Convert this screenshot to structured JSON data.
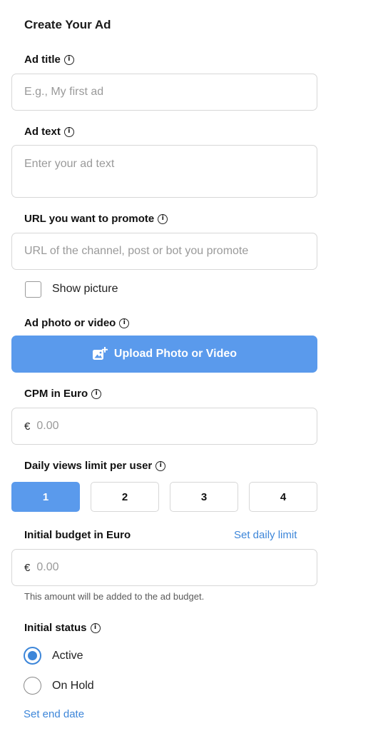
{
  "page_title": "Create Your Ad",
  "ad_title": {
    "label": "Ad title",
    "placeholder": "E.g., My first ad"
  },
  "ad_text": {
    "label": "Ad text",
    "placeholder": "Enter your ad text"
  },
  "url": {
    "label": "URL you want to promote",
    "placeholder": "URL of the channel, post or bot you promote"
  },
  "show_picture": {
    "label": "Show picture",
    "checked": false
  },
  "media": {
    "label": "Ad photo or video",
    "button_label": "Upload Photo or Video",
    "icon": "add-photo-icon"
  },
  "cpm": {
    "label": "CPM in Euro",
    "currency": "€",
    "placeholder": "0.00"
  },
  "daily_views": {
    "label": "Daily views limit per user",
    "options": [
      "1",
      "2",
      "3",
      "4"
    ],
    "selected": "1"
  },
  "budget": {
    "label": "Initial budget in Euro",
    "link": "Set daily limit",
    "currency": "€",
    "placeholder": "0.00",
    "hint": "This amount will be added to the ad budget."
  },
  "status": {
    "label": "Initial status",
    "options": [
      "Active",
      "On Hold"
    ],
    "selected": "Active"
  },
  "end_date_link": "Set end date",
  "colors": {
    "accent": "#5a9aec",
    "link": "#3d86d9",
    "border": "#d7d7d7"
  }
}
